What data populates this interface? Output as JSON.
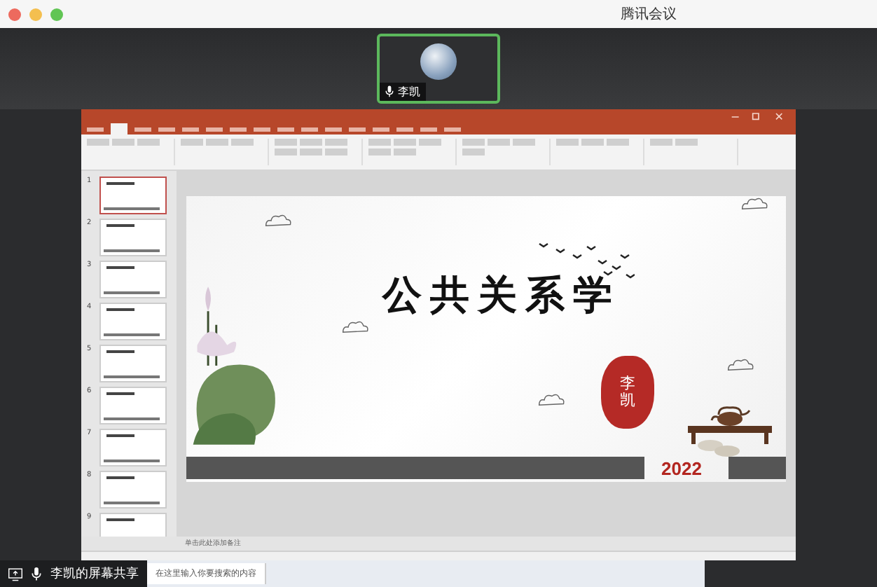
{
  "window": {
    "title": "腾讯会议"
  },
  "participants": [
    {
      "name": "李凯",
      "speaking": true
    }
  ],
  "presentation": {
    "slides": [
      {
        "number": "1",
        "selected": true
      },
      {
        "number": "2",
        "selected": false
      },
      {
        "number": "3",
        "selected": false
      },
      {
        "number": "4",
        "selected": false
      },
      {
        "number": "5",
        "selected": false
      },
      {
        "number": "6",
        "selected": false
      },
      {
        "number": "7",
        "selected": false
      },
      {
        "number": "8",
        "selected": false
      },
      {
        "number": "9",
        "selected": false
      }
    ],
    "current_slide": {
      "title": "公共关系学",
      "seal_text": "李凯",
      "year": "2022"
    },
    "notes": {
      "placeholder": "单击此处添加备注"
    }
  },
  "share_label": "李凯的屏幕共享",
  "taskbar": {
    "search": {
      "placeholder": "在这里输入你要搜索的内容"
    }
  }
}
